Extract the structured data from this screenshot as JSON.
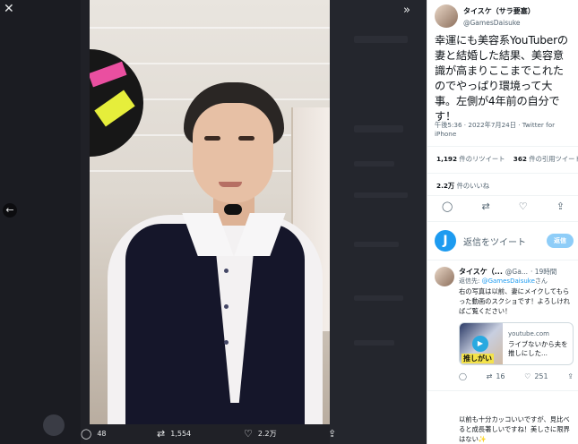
{
  "viewer": {
    "collapse_icon": "double-chevron-right",
    "prev_icon": "arrow-left",
    "actions": [
      {
        "icon": "reply",
        "glyph": "💬",
        "count": "48"
      },
      {
        "icon": "retweet",
        "glyph": "⇄",
        "count": "1,554"
      },
      {
        "icon": "like",
        "glyph": "♡",
        "count": "2.2万"
      },
      {
        "icon": "share",
        "glyph": "⇪",
        "count": ""
      }
    ]
  },
  "tweet": {
    "author_name": "タイスケ（サラ要塞）",
    "author_handle": "@GamesDaisuke",
    "text": "幸運にも美容系YouTuberの妻と結婚した結果、美容意識が高まりここまでこれたのでやっぱり環境って大事。左側が4年前の自分です！",
    "timestamp": "午後5:36 · 2022年7月24日 · Twitter for iPhone",
    "retweets_count": "1,192",
    "retweets_label": "件のリツイート",
    "quotes_count": "362",
    "quotes_label": "件の引用ツイート",
    "likes_count": "2.2万",
    "likes_label": "件のいいね",
    "icons": [
      "reply-icon",
      "retweet-icon",
      "like-icon",
      "share-icon"
    ]
  },
  "compose": {
    "avatar_letter": "J",
    "placeholder": "返信をツイート",
    "button": "返信"
  },
  "reply1": {
    "author_name": "タイスケ（...",
    "author_handle": "@Ga...",
    "time": "· 19時間",
    "to_prefix": "返信先:",
    "to_handle": "@GamesDaisuke",
    "to_suffix": "さん",
    "text": "右の写真は以前、妻にメイクしてもらった動画のスクショです！よろしければご覧ください！",
    "card_domain": "youtube.com",
    "card_title": "ライブないから夫を推しにした...",
    "card_thumb_text": "推しがい",
    "retweets": "16",
    "likes": "251"
  },
  "reply2": {
    "text": "以前も十分カッコいいですが、見比べると成長著しいですね！美しさに限界はない✨"
  },
  "colors": {
    "accent": "#1d9bf0",
    "viewer_bg": "#202127",
    "panel_bg": "#ffffff"
  }
}
